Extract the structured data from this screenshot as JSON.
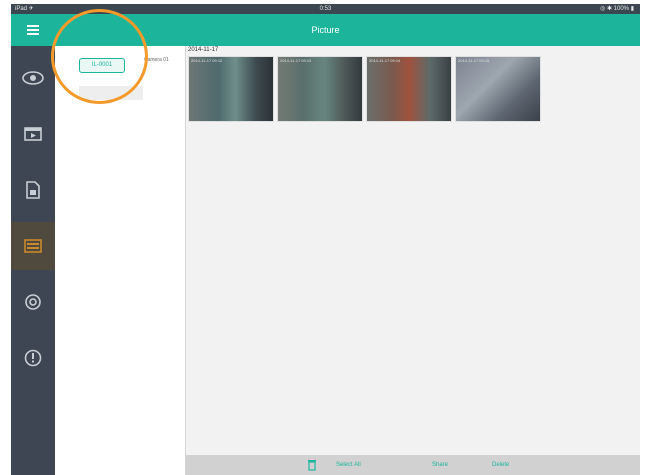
{
  "statusbar": {
    "left": "iPad ✈",
    "center": "0:53",
    "right": "◎ ✱ 100% ▮"
  },
  "header": {
    "title": "Picture"
  },
  "sidebar": {
    "items": [
      {
        "name": "live-view",
        "icon": "eye-icon"
      },
      {
        "name": "playback",
        "icon": "playback-icon"
      },
      {
        "name": "files",
        "icon": "file-icon"
      },
      {
        "name": "pictures",
        "icon": "picture-icon",
        "active": true
      },
      {
        "name": "settings",
        "icon": "gear-icon"
      },
      {
        "name": "info",
        "icon": "info-icon"
      }
    ]
  },
  "list": {
    "channel_tag": "IL-0001",
    "channel_name": "Camera 01"
  },
  "main": {
    "date": "2014-11-17",
    "thumbnails": [
      {
        "caption": "2014-11-17 09:12"
      },
      {
        "caption": "2014-11-17 09:13"
      },
      {
        "caption": "2014-11-17 09:14"
      },
      {
        "caption": "2014-11-17 09:15"
      }
    ]
  },
  "bottombar": {
    "select_all": "Select All",
    "share": "Share",
    "delete": "Delete"
  },
  "colors": {
    "accent": "#1cb59c",
    "sidebar": "#3d4652",
    "highlight": "#f39a2b"
  }
}
